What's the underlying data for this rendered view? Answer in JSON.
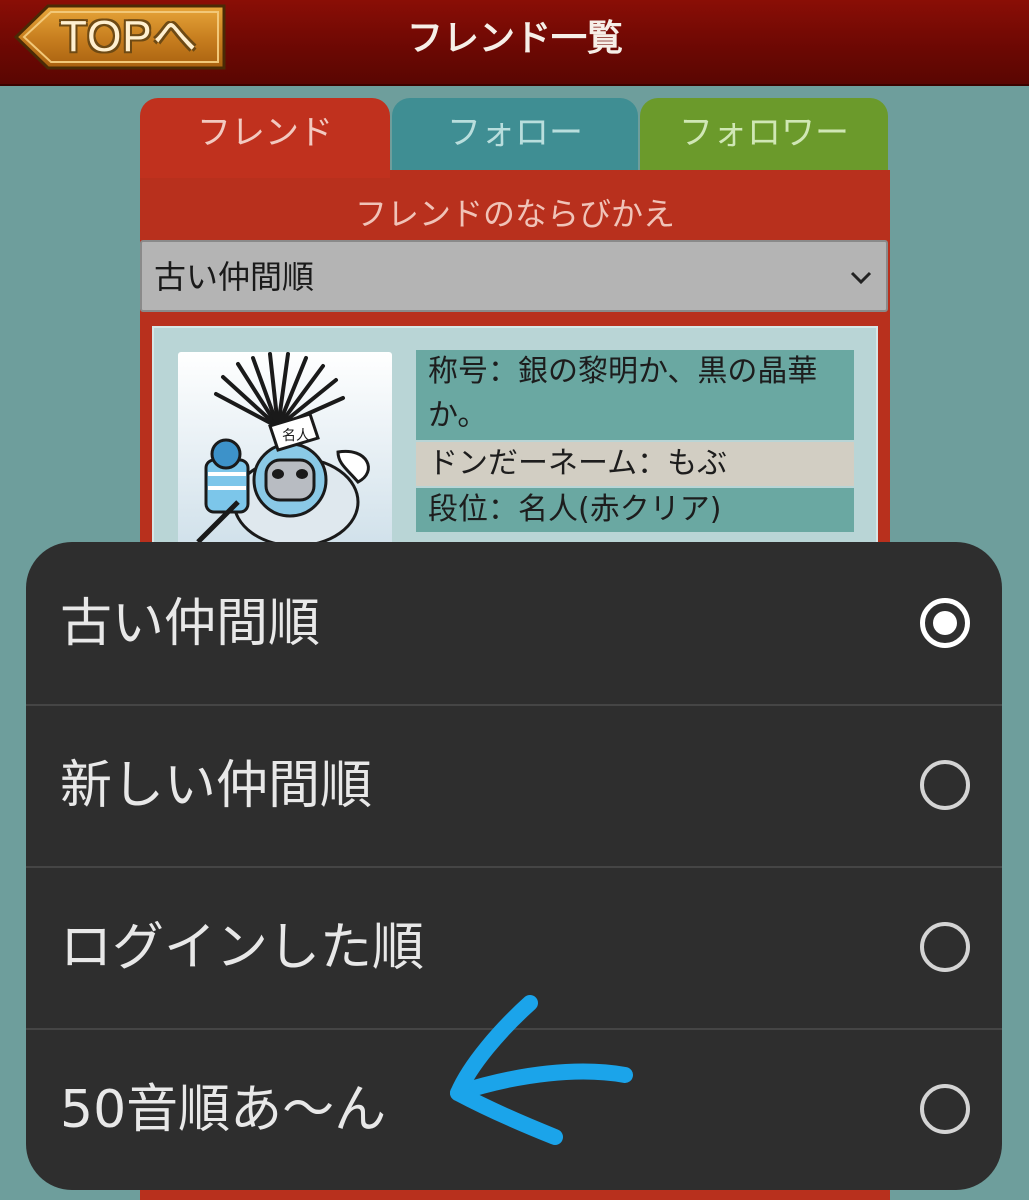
{
  "header": {
    "back_label": "TOPへ",
    "title": "フレンド一覧"
  },
  "tabs": [
    {
      "label": "フレンド",
      "active": true
    },
    {
      "label": "フォロー",
      "active": false
    },
    {
      "label": "フォロワー",
      "active": false
    }
  ],
  "sort": {
    "label": "フレンドのならびかえ",
    "selected": "古い仲間順"
  },
  "friend": {
    "title_line1": "称号：銀の黎明か、黒の晶華",
    "title_line2": "か。",
    "name": "ドンだーネーム：もぶ",
    "rank": "段位：名人(赤クリア)",
    "avatar_badge": "名人"
  },
  "dialog": {
    "options": [
      {
        "label": "古い仲間順",
        "checked": true
      },
      {
        "label": "新しい仲間順",
        "checked": false
      },
      {
        "label": "ログインした順",
        "checked": false
      },
      {
        "label": "50音順あ〜ん",
        "checked": false
      }
    ]
  },
  "colors": {
    "header": "#7a0b05",
    "background": "#6e9e9c",
    "tab_friend": "#c0311e",
    "tab_follow": "#3f8e93",
    "tab_follower": "#6b9a2b",
    "dialog_bg": "#2e2e2e",
    "annotation_arrow": "#1ba4ea"
  },
  "icons": [
    "back-arrow-icon",
    "chevron-down-icon",
    "radio-checked-icon",
    "radio-unchecked-icon",
    "hand-drawn-arrow-icon"
  ]
}
